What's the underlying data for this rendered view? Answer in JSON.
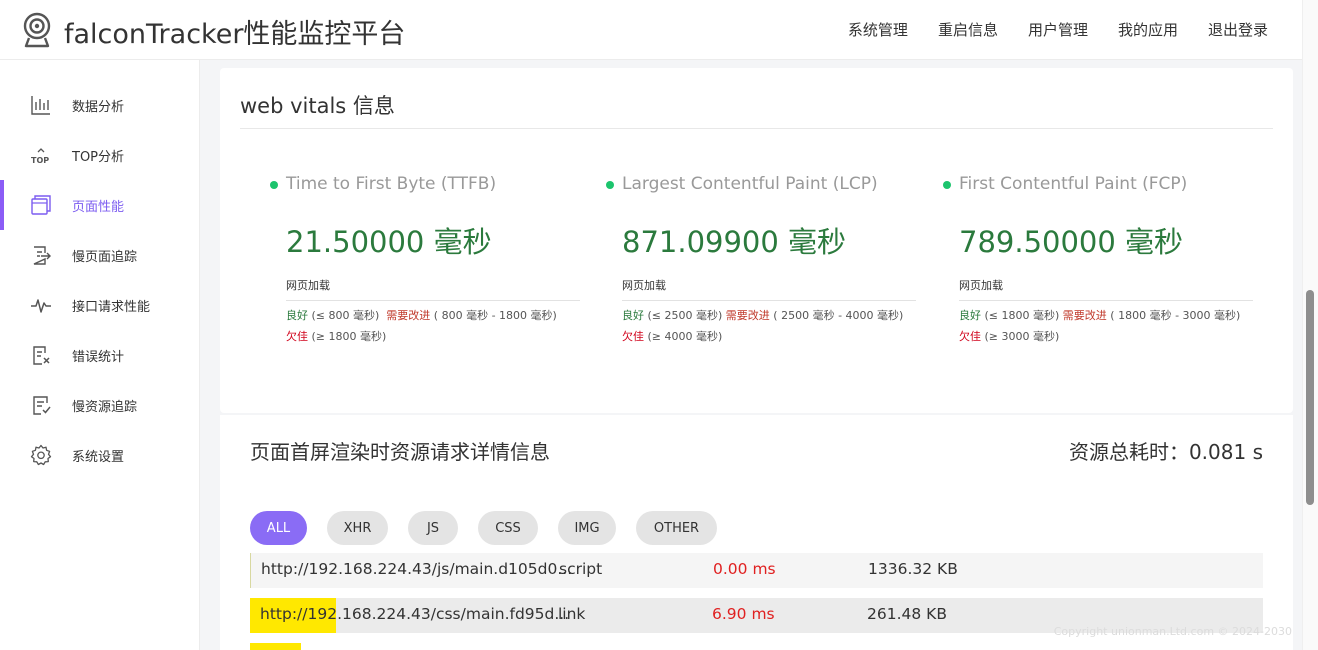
{
  "header": {
    "title": "falconTracker性能监控平台",
    "nav": [
      "系统管理",
      "重启信息",
      "用户管理",
      "我的应用",
      "退出登录"
    ]
  },
  "sidebar": {
    "items": [
      {
        "label": "数据分析",
        "icon": "bar-chart-icon"
      },
      {
        "label": "TOP分析",
        "icon": "top-icon"
      },
      {
        "label": "页面性能",
        "icon": "pages-icon",
        "active": true
      },
      {
        "label": "慢页面追踪",
        "icon": "slow-page-icon"
      },
      {
        "label": "接口请求性能",
        "icon": "pulse-icon"
      },
      {
        "label": "错误统计",
        "icon": "error-doc-icon"
      },
      {
        "label": "慢资源追踪",
        "icon": "slow-resource-icon"
      },
      {
        "label": "系统设置",
        "icon": "gear-icon"
      }
    ]
  },
  "vitals": {
    "title": "web vitals 信息",
    "metrics": [
      {
        "name": "Time to First Byte (TTFB)",
        "value": "21.50000 毫秒",
        "sub": "网页加载",
        "good_label": "良好",
        "good_range": "(≤ 800 毫秒)",
        "warn_label": "需要改进",
        "warn_range": "( 800 毫秒 - 1800 毫秒)",
        "bad_label": "欠佳",
        "bad_range": "(≥ 1800 毫秒)"
      },
      {
        "name": "Largest Contentful Paint (LCP)",
        "value": "871.09900 毫秒",
        "sub": "网页加载",
        "good_label": "良好",
        "good_range": "(≤ 2500 毫秒)",
        "warn_label": "需要改进",
        "warn_range": "( 2500 毫秒 - 4000 毫秒)",
        "bad_label": "欠佳",
        "bad_range": "(≥ 4000 毫秒)"
      },
      {
        "name": "First Contentful Paint (FCP)",
        "value": "789.50000 毫秒",
        "sub": "网页加载",
        "good_label": "良好",
        "good_range": "(≤ 1800 毫秒)",
        "warn_label": "需要改进",
        "warn_range": "( 1800 毫秒 - 3000 毫秒)",
        "bad_label": "欠佳",
        "bad_range": "(≥ 3000 毫秒)"
      }
    ]
  },
  "resources": {
    "title": "页面首屏渲染时资源请求详情信息",
    "total_label": "资源总耗时：",
    "total_value": "0.081 s",
    "filters": [
      "ALL",
      "XHR",
      "JS",
      "CSS",
      "IMG",
      "OTHER"
    ],
    "active_filter": "ALL",
    "rows": [
      {
        "url": "http://192.168.224.43/js/main.d105d0...",
        "type": "script",
        "time": "0.00 ms",
        "size": "1336.32 KB",
        "bar_fraction": 0.0
      },
      {
        "url": "http://192.168.224.43/css/main.fd95d...",
        "type": "link",
        "time": "6.90 ms",
        "size": "261.48 KB",
        "bar_fraction": 0.085
      }
    ]
  },
  "footer": {
    "copyright": "Copyright unionman.Ltd.com © 2024-2030"
  },
  "colors": {
    "accent": "#8a6cf5",
    "good": "#2b7a3d",
    "dot": "#1cc46d",
    "danger": "#e02020",
    "bar": "#ffe800"
  }
}
